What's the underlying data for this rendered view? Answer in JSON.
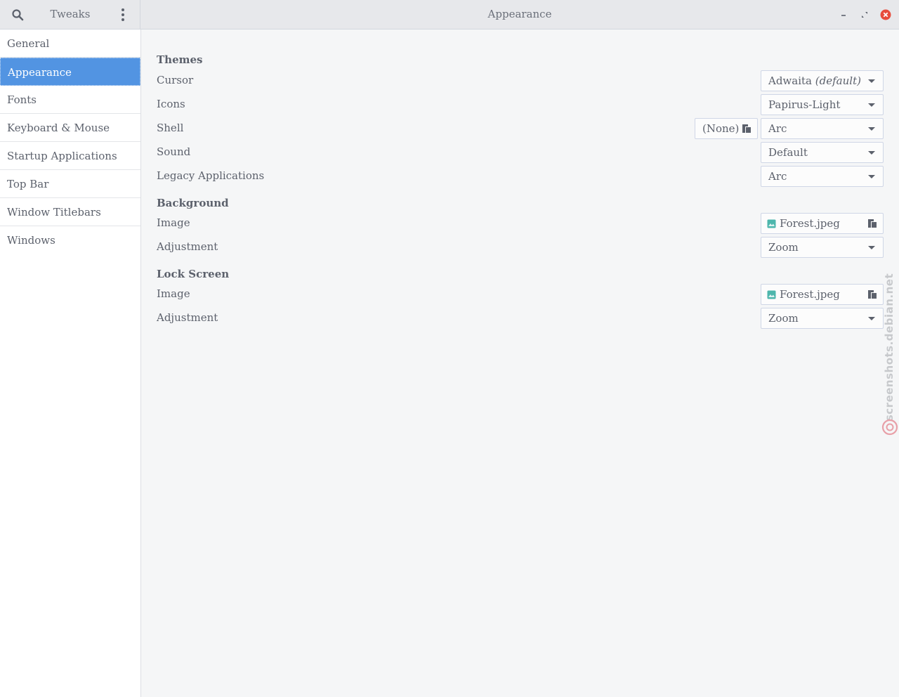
{
  "titlebar": {
    "app_title": "Tweaks",
    "window_title": "Appearance",
    "icons": {
      "search": "search-icon",
      "menu": "vertical-dots-menu-icon",
      "minimize": "minimize-icon",
      "maximize": "maximize-icon",
      "close": "close-icon"
    },
    "close_color": "#e74c3c"
  },
  "sidebar": {
    "selected_index": 1,
    "accent_color": "#5294e2",
    "items": [
      {
        "label": "General"
      },
      {
        "label": "Appearance"
      },
      {
        "label": "Fonts"
      },
      {
        "label": "Keyboard & Mouse"
      },
      {
        "label": "Startup Applications"
      },
      {
        "label": "Top Bar"
      },
      {
        "label": "Window Titlebars"
      },
      {
        "label": "Windows"
      }
    ]
  },
  "themes": {
    "heading": "Themes",
    "cursor": {
      "label": "Cursor",
      "value": "Adwaita",
      "value_note": "(default)"
    },
    "icons": {
      "label": "Icons",
      "value": "Papirus-Light"
    },
    "shell": {
      "label": "Shell",
      "file_value": "(None)",
      "value": "Arc"
    },
    "sound": {
      "label": "Sound",
      "value": "Default"
    },
    "legacy": {
      "label": "Legacy Applications",
      "value": "Arc"
    }
  },
  "background": {
    "heading": "Background",
    "image": {
      "label": "Image",
      "value": "Forest.jpeg"
    },
    "adjustment": {
      "label": "Adjustment",
      "value": "Zoom"
    }
  },
  "lock_screen": {
    "heading": "Lock Screen",
    "image": {
      "label": "Image",
      "value": "Forest.jpeg"
    },
    "adjustment": {
      "label": "Adjustment",
      "value": "Zoom"
    }
  },
  "watermark": {
    "text": "screenshots.debian.net",
    "logo": "debian-swirl-icon",
    "color": "#e8a0a8"
  }
}
